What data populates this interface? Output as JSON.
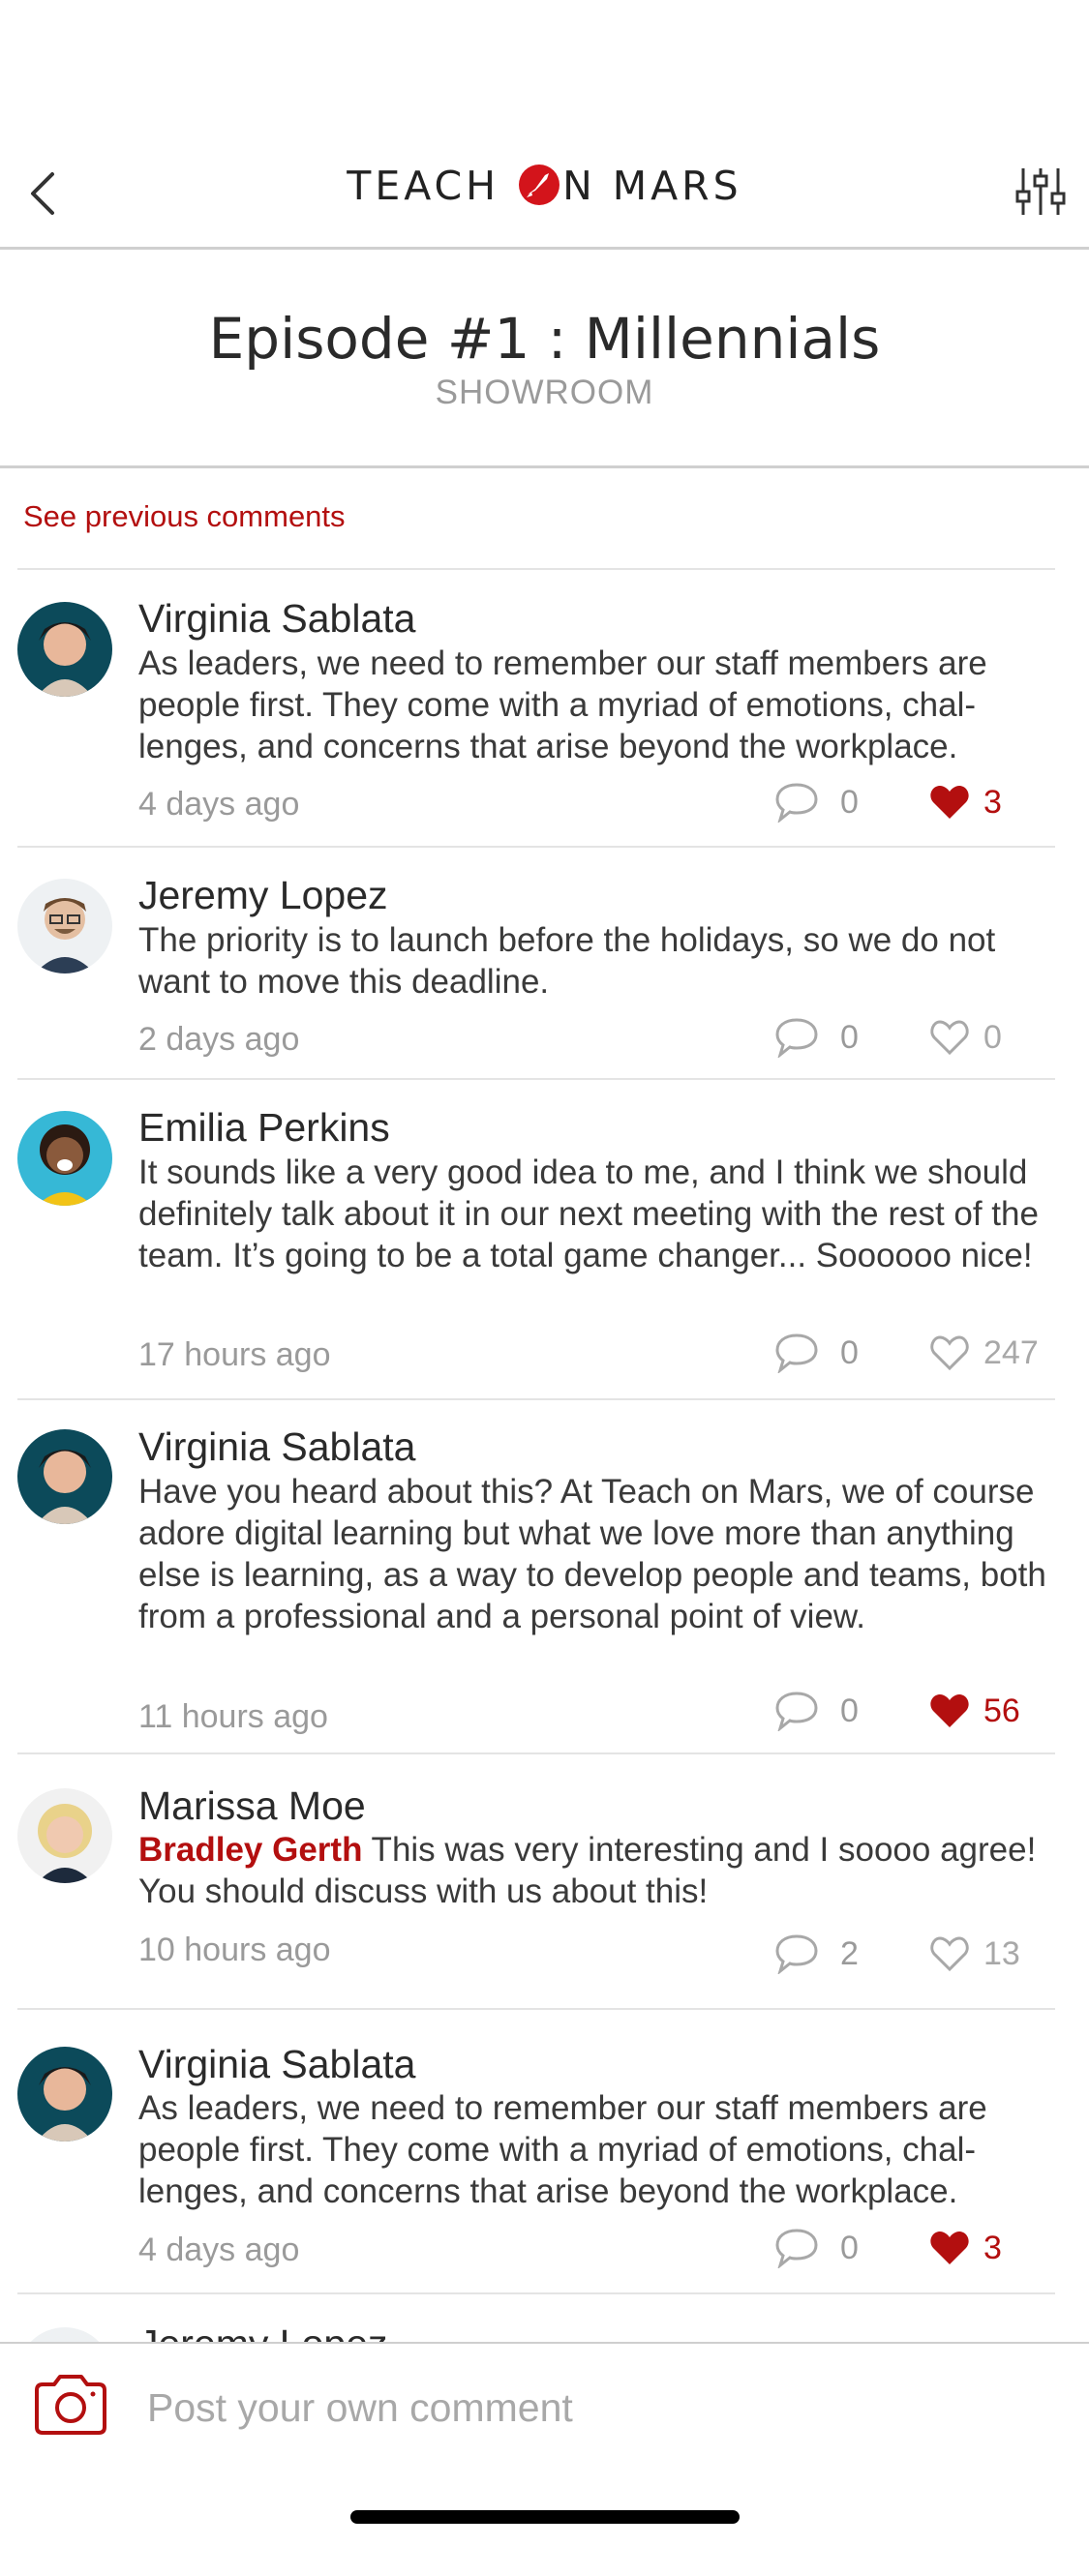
{
  "header": {
    "brand_pre": "TEACH ",
    "brand_post": "N MARS",
    "back_icon": "chevron-left-icon",
    "filter_icon": "sliders-icon"
  },
  "episode": {
    "title": "Episode #1 : Millennials",
    "subtitle": "SHOWROOM"
  },
  "see_previous": "See previous comments",
  "comments": [
    {
      "author": "Virginia Sablata",
      "text": "As leaders, we need to remember our staff members are people first. They come with a myriad of emotions, chal-lenges, and concerns that arise beyond the workplace.",
      "time": "4 days ago",
      "replies": "0",
      "likes": "3",
      "liked": true
    },
    {
      "author": "Jeremy Lopez",
      "text": "The priority is to launch before the holidays, so we do not want to move this deadline.",
      "time": "2 days ago",
      "replies": "0",
      "likes": "0",
      "liked": false
    },
    {
      "author": "Emilia Perkins",
      "text": "It sounds like a very good idea to me, and I think we should definitely talk about it in our next meeting with the rest of the team. It’s going to be a total game changer... Soooooo nice!",
      "time": "17 hours ago",
      "replies": "0",
      "likes": "247",
      "liked": false
    },
    {
      "author": "Virginia Sablata",
      "text": "Have you heard about this? At Teach on Mars, we of course adore digital learning but what we love more than anything else is learning, as a way to develop people and teams, both from a professional and a personal point of view.",
      "time": "11 hours ago",
      "replies": "0",
      "likes": "56",
      "liked": true
    },
    {
      "author": "Marissa Moe",
      "mention": "Bradley Gerth",
      "text": " This was very interesting and I soooo agree! You should discuss with us about this!",
      "time": "10 hours ago",
      "replies": "2",
      "likes": "13",
      "liked": false
    },
    {
      "author": "Virginia Sablata",
      "text": "As leaders, we need to remember our staff members are people first. They come with a myriad of emotions, chal-lenges, and concerns that arise beyond the workplace.",
      "time": "4 days ago",
      "replies": "0",
      "likes": "3",
      "liked": true
    }
  ],
  "peek_author": "Jeremy Lopez",
  "composer": {
    "placeholder": "Post your own comment",
    "camera_icon": "camera-icon"
  },
  "colors": {
    "accent": "#b30f0f",
    "muted": "#9a9a9a",
    "divider": "#e4e4e4"
  }
}
